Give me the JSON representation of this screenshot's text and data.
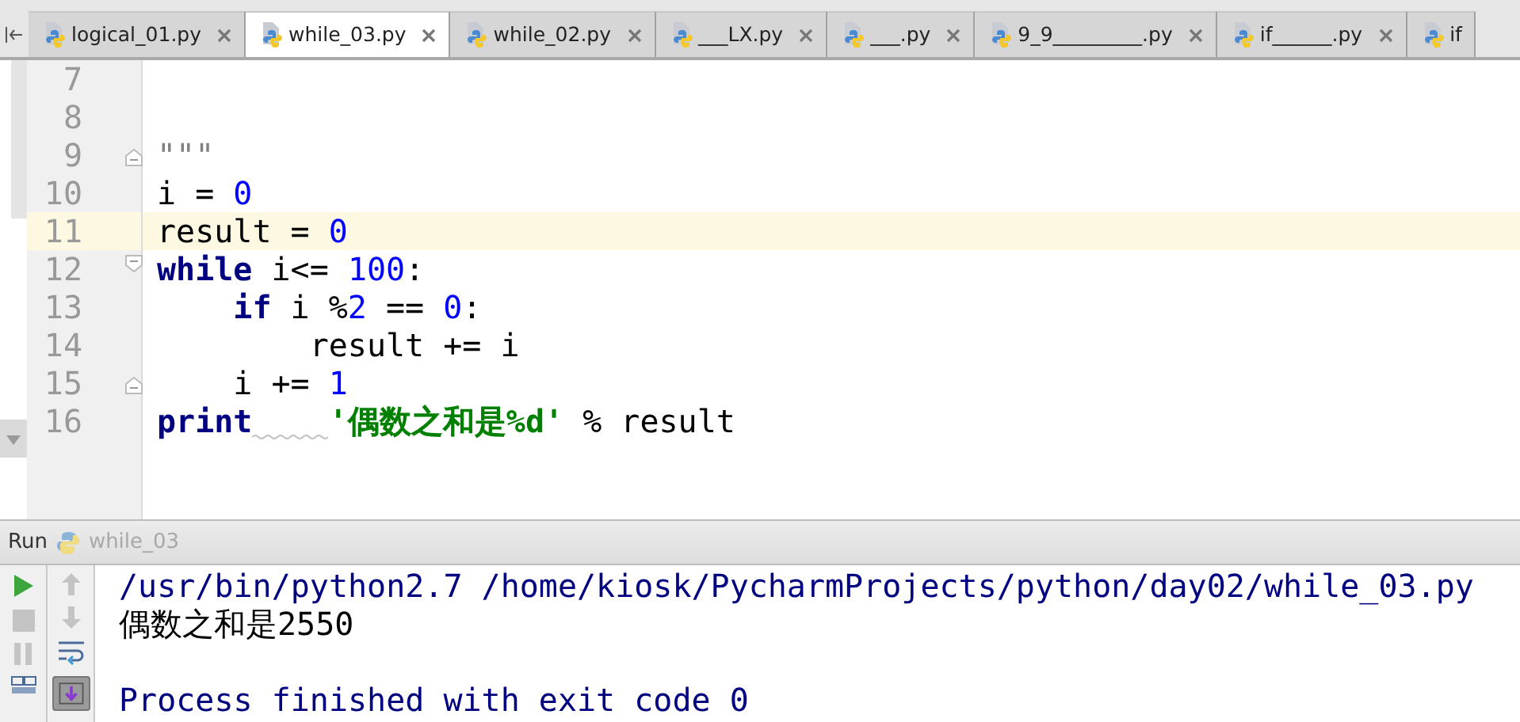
{
  "tabs": [
    {
      "label": "logical_01.py",
      "selected": false,
      "closable": true
    },
    {
      "label": "while_03.py",
      "selected": true,
      "closable": true
    },
    {
      "label": "while_02.py",
      "selected": false,
      "closable": true
    },
    {
      "label": "___LX.py",
      "selected": false,
      "closable": true
    },
    {
      "label": "___.py",
      "selected": false,
      "closable": true
    },
    {
      "label": "9_9_________.py",
      "selected": false,
      "closable": true
    },
    {
      "label": "if______.py",
      "selected": false,
      "closable": true
    },
    {
      "label": "if",
      "selected": false,
      "closable": false
    }
  ],
  "editor": {
    "lines": [
      {
        "number": "7",
        "current": false,
        "fold_start": false,
        "fold_end": false
      },
      {
        "number": "8",
        "current": false,
        "fold_start": false,
        "fold_end": false
      },
      {
        "number": "9",
        "current": false,
        "fold_start": false,
        "fold_end": true,
        "tokens": [
          {
            "text": "\"\"\"",
            "kind": "docstring"
          }
        ]
      },
      {
        "number": "10",
        "current": false,
        "fold_start": false,
        "fold_end": false,
        "tokens": [
          {
            "text": "i = ",
            "kind": "plain"
          },
          {
            "text": "0",
            "kind": "number"
          }
        ]
      },
      {
        "number": "11",
        "current": true,
        "fold_start": false,
        "fold_end": false,
        "tokens": [
          {
            "text": "result = ",
            "kind": "plain"
          },
          {
            "text": "0",
            "kind": "number"
          }
        ]
      },
      {
        "number": "12",
        "current": false,
        "fold_start": true,
        "fold_end": false,
        "tokens": [
          {
            "text": "while",
            "kind": "keyword"
          },
          {
            "text": " i<= ",
            "kind": "plain"
          },
          {
            "text": "100",
            "kind": "number"
          },
          {
            "text": ":",
            "kind": "plain"
          }
        ]
      },
      {
        "number": "13",
        "current": false,
        "fold_start": false,
        "fold_end": false,
        "tokens": [
          {
            "text": "    if",
            "kind": "keyword"
          },
          {
            "text": " i %",
            "kind": "plain"
          },
          {
            "text": "2",
            "kind": "number"
          },
          {
            "text": " == ",
            "kind": "plain"
          },
          {
            "text": "0",
            "kind": "number"
          },
          {
            "text": ":",
            "kind": "plain"
          }
        ]
      },
      {
        "number": "14",
        "current": false,
        "fold_start": false,
        "fold_end": false,
        "tokens": [
          {
            "text": "        result += i",
            "kind": "plain"
          }
        ]
      },
      {
        "number": "15",
        "current": false,
        "fold_start": false,
        "fold_end": true,
        "tokens": [
          {
            "text": "    i += ",
            "kind": "plain"
          },
          {
            "text": "1",
            "kind": "number"
          }
        ]
      },
      {
        "number": "16",
        "current": false,
        "fold_start": false,
        "fold_end": false,
        "tokens": [
          {
            "text": "print",
            "kind": "keyword",
            "warning_after": true
          },
          {
            "text": "'偶数之和是%d'",
            "kind": "string"
          },
          {
            "text": " % result",
            "kind": "plain"
          }
        ]
      }
    ]
  },
  "run": {
    "label": "Run",
    "config": "while_03",
    "console": [
      {
        "text": "/usr/bin/python2.7 /home/kiosk/PycharmProjects/python/day02/while_03.py",
        "kind": "command"
      },
      {
        "text": "偶数之和是2550",
        "kind": "output"
      },
      {
        "text": "Process finished with exit code 0",
        "kind": "exit"
      }
    ]
  }
}
